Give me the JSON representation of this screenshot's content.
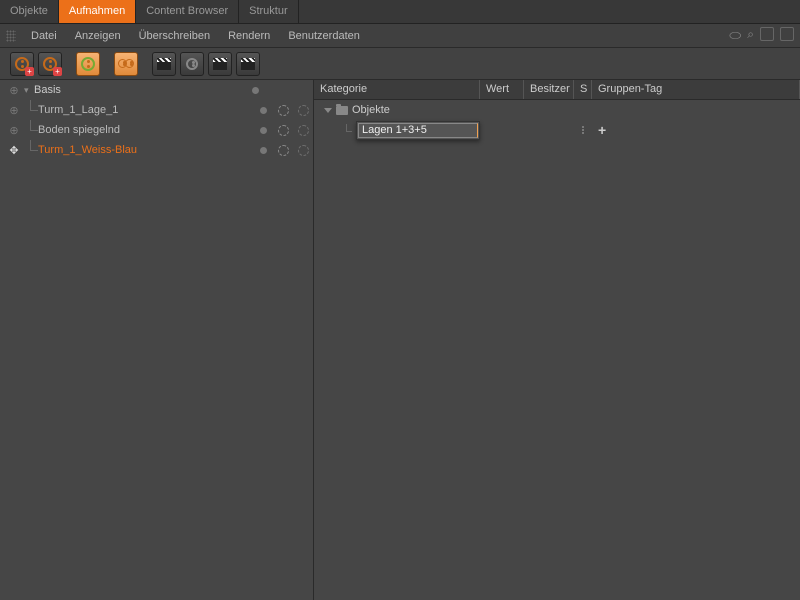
{
  "tabs": {
    "objekte": "Objekte",
    "aufnahmen": "Aufnahmen",
    "content": "Content Browser",
    "struktur": "Struktur"
  },
  "menu": {
    "datei": "Datei",
    "anzeigen": "Anzeigen",
    "ueberschreiben": "Überschreiben",
    "rendern": "Rendern",
    "benutzerdaten": "Benutzerdaten"
  },
  "tree": {
    "root": "Basis",
    "items": [
      {
        "label": "Turm_1_Lage_1"
      },
      {
        "label": "Boden spiegelnd"
      },
      {
        "label": "Turm_1_Weiss-Blau",
        "selected": true
      }
    ]
  },
  "columns": {
    "kategorie": "Kategorie",
    "wert": "Wert",
    "besitzer": "Besitzer",
    "s": "S",
    "gruppentag": "Gruppen-Tag"
  },
  "category": {
    "root": "Objekte",
    "edit_value": "Lagen 1+3+5"
  }
}
